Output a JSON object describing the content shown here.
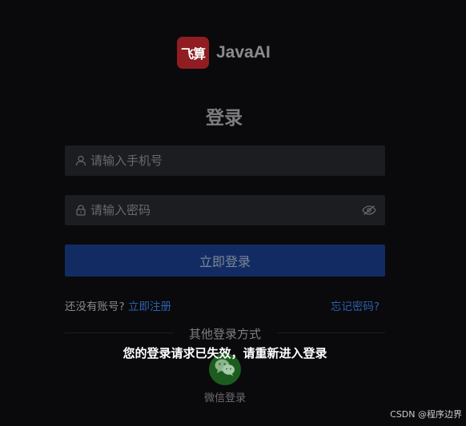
{
  "brand": {
    "logo_text": "飞算",
    "name": "JavaAI"
  },
  "login": {
    "title": "登录",
    "phone_placeholder": "请输入手机号",
    "password_placeholder": "请输入密码",
    "submit_label": "立即登录"
  },
  "register": {
    "prompt": "还没有账号?",
    "link": "立即注册"
  },
  "forgot_link": "忘记密码?",
  "other_login": {
    "divider_text": "其他登录方式",
    "wechat_label": "微信登录"
  },
  "toast": "您的登录请求已失效，请重新进入登录",
  "watermark": "CSDN @程序边界",
  "colors": {
    "background": "#0a0a0c",
    "brand_red": "#8f1d22",
    "button_blue": "#122c63",
    "link_blue": "#2e5fb0",
    "wechat_green": "#1d5c1f"
  },
  "icons": {
    "phone_field": "user-icon",
    "password_field": "lock-icon",
    "toggle_password": "eye-off-icon",
    "wechat": "wechat-icon"
  }
}
